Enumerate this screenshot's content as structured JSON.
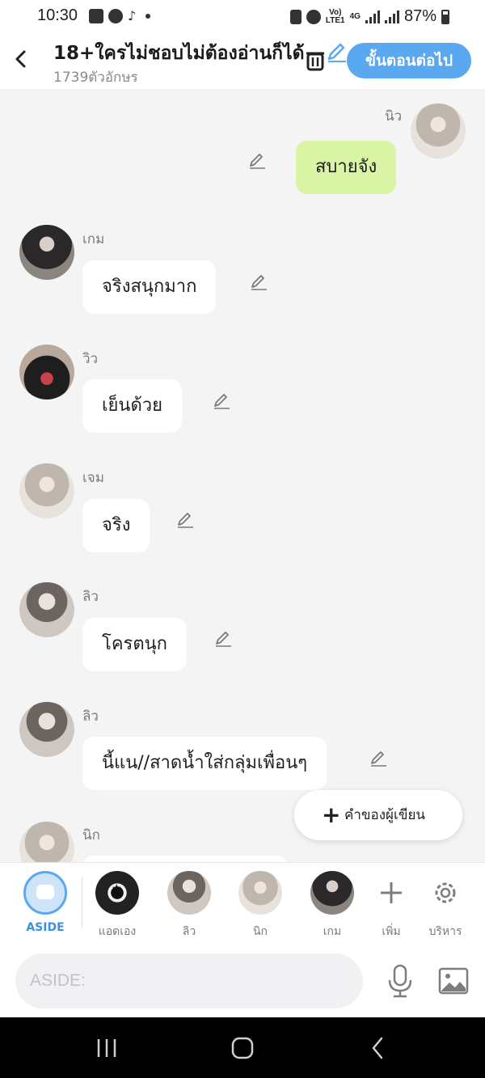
{
  "status_bar": {
    "time": "10:30",
    "network_top": "Vo)",
    "network_bottom": "LTE1",
    "data_type": "4G",
    "battery": "87%"
  },
  "header": {
    "title": "18+ใครไม่ชอบไม่ต้องอ่านก็ได้",
    "char_count": "1739ตัวอักษร",
    "next_label": "ขั้นตอนต่อไป"
  },
  "messages": [
    {
      "sender": "นิว",
      "text": "สบายจัง",
      "side": "right"
    },
    {
      "sender": "เกม",
      "text": "จริงสนุกมาก",
      "side": "left"
    },
    {
      "sender": "วิว",
      "text": "เย็นด้วย",
      "side": "left"
    },
    {
      "sender": "เจม",
      "text": "จริง",
      "side": "left"
    },
    {
      "sender": "ลิว",
      "text": "โครตนุก",
      "side": "left"
    },
    {
      "sender": "ลิว",
      "text": "นี้แน//สาดน้ำใส่กลุ่มเพื่อนๆ",
      "side": "left"
    },
    {
      "sender": "นิก",
      "text": "",
      "side": "left"
    }
  ],
  "author_note_label": "คำของผู้เขียน",
  "character_bar": {
    "aside_label": "ASIDE",
    "characters": [
      "แอดเอง",
      "ลิว",
      "นิก",
      "เกม"
    ],
    "add_label": "เพิ่ม",
    "manage_label": "บริหาร"
  },
  "input": {
    "placeholder": "ASIDE:"
  },
  "icons": {
    "back": "back-arrow-icon",
    "trash": "trash-icon",
    "pencil": "pencil-icon",
    "mic": "microphone-icon",
    "image": "image-icon",
    "gear": "gear-icon",
    "plus": "plus-icon"
  },
  "colors": {
    "accent": "#5aa8f0",
    "my_bubble": "#d9f4a5",
    "background": "#f4f4f5"
  }
}
